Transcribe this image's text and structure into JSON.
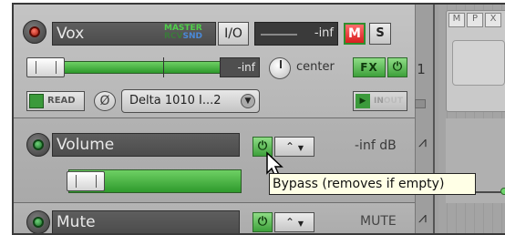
{
  "tracks": {
    "vox": {
      "name": "Vox",
      "routing_top": "MASTER",
      "routing_bottom_a": "RCV",
      "routing_bottom_b": "SND",
      "io_label": "I/O",
      "peak_value": "-inf",
      "mute_label": "M",
      "solo_label": "S",
      "volume_readout": "-inf",
      "pan_label": "center",
      "fx_label": "FX",
      "number": "1",
      "automation_mode": "READ",
      "input_device": "Delta 1010 I...2",
      "monitor_label": "IN",
      "monitor_label_suffix": "OUT"
    },
    "volume_env": {
      "name": "Volume",
      "readout": "-inf dB"
    },
    "mute_env": {
      "name": "Mute",
      "readout": "MUTE"
    }
  },
  "tooltip": {
    "text": "Bypass (removes if empty)"
  },
  "arrange": {
    "item_buttons": [
      "M",
      "P",
      "X"
    ]
  }
}
